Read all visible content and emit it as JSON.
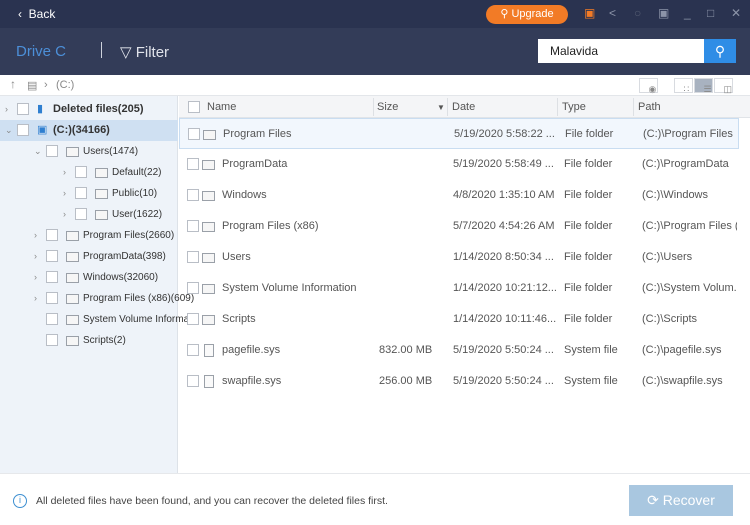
{
  "topbar": {
    "back_label": "Back",
    "upgrade_label": "Upgrade"
  },
  "toolbar": {
    "drive_tab": "Drive C",
    "filter_label": "Filter",
    "search_value": "Malavida"
  },
  "breadcrumb": {
    "path": "(C:)"
  },
  "tree": [
    {
      "label": "Deleted files(205)",
      "level": 0,
      "expand": ">"
    },
    {
      "label": "(C:)(34166)",
      "level": 0,
      "expand": "v",
      "selected": true
    },
    {
      "label": "Users(1474)",
      "level": 1,
      "expand": "v"
    },
    {
      "label": "Default(22)",
      "level": 2,
      "expand": ">"
    },
    {
      "label": "Public(10)",
      "level": 2,
      "expand": ">"
    },
    {
      "label": "User(1622)",
      "level": 2,
      "expand": ">"
    },
    {
      "label": "Program Files(2660)",
      "level": 1,
      "expand": ">"
    },
    {
      "label": "ProgramData(398)",
      "level": 1,
      "expand": ">"
    },
    {
      "label": "Windows(32060)",
      "level": 1,
      "expand": ">"
    },
    {
      "label": "Program Files (x86)(609)",
      "level": 1,
      "expand": ">"
    },
    {
      "label": "System Volume Informa",
      "level": 1,
      "expand": ""
    },
    {
      "label": "Scripts(2)",
      "level": 1,
      "expand": ""
    }
  ],
  "table": {
    "columns": [
      "Name",
      "Size",
      "Date",
      "Type",
      "Path"
    ],
    "rows": [
      {
        "name": "Program Files",
        "size": "",
        "date": "5/19/2020 5:58:22 ...",
        "type": "File folder",
        "path": "(C:)\\Program Files",
        "icon": "folder"
      },
      {
        "name": "ProgramData",
        "size": "",
        "date": "5/19/2020 5:58:49 ...",
        "type": "File folder",
        "path": "(C:)\\ProgramData",
        "icon": "folder"
      },
      {
        "name": "Windows",
        "size": "",
        "date": "4/8/2020 1:35:10 AM",
        "type": "File folder",
        "path": "(C:)\\Windows",
        "icon": "folder"
      },
      {
        "name": "Program Files (x86)",
        "size": "",
        "date": "5/7/2020 4:54:26 AM",
        "type": "File folder",
        "path": "(C:)\\Program Files (...",
        "icon": "folder"
      },
      {
        "name": "Users",
        "size": "",
        "date": "1/14/2020 8:50:34 ...",
        "type": "File folder",
        "path": "(C:)\\Users",
        "icon": "folder"
      },
      {
        "name": "System Volume Information",
        "size": "",
        "date": "1/14/2020 10:21:12...",
        "type": "File folder",
        "path": "(C:)\\System Volum...",
        "icon": "folder"
      },
      {
        "name": "Scripts",
        "size": "",
        "date": "1/14/2020 10:11:46...",
        "type": "File folder",
        "path": "(C:)\\Scripts",
        "icon": "folder"
      },
      {
        "name": "pagefile.sys",
        "size": "832.00 MB",
        "date": "5/19/2020 5:50:24 ...",
        "type": "System file",
        "path": "(C:)\\pagefile.sys",
        "icon": "file"
      },
      {
        "name": "swapfile.sys",
        "size": "256.00 MB",
        "date": "5/19/2020 5:50:24 ...",
        "type": "System file",
        "path": "(C:)\\swapfile.sys",
        "icon": "file"
      }
    ]
  },
  "footer": {
    "message": "All deleted files have been found, and you can recover the deleted files first.",
    "recover_label": "Recover"
  },
  "colors": {
    "accent": "#2f8de6",
    "upgrade": "#f27b26",
    "topbar": "#2a3350"
  }
}
